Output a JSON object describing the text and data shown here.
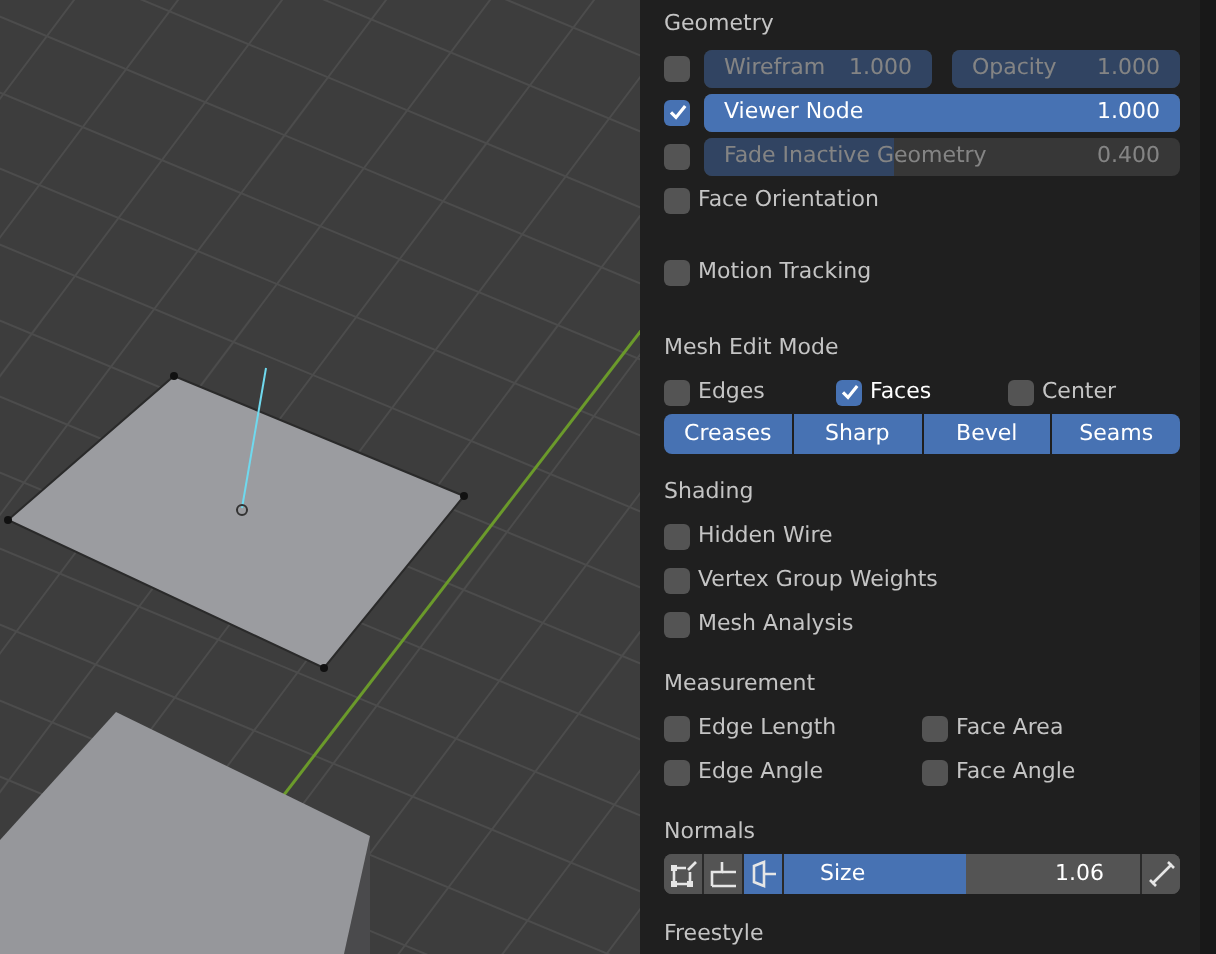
{
  "geometry": {
    "title": "Geometry",
    "items": [
      {
        "kind": "sliders",
        "checked": false,
        "sliders": [
          {
            "label": "Wirefram",
            "value": "1.000",
            "level": 1
          },
          {
            "label": "Opacity",
            "value": "1.000",
            "level": 1
          }
        ]
      },
      {
        "kind": "sliders",
        "checked": true,
        "sliders": [
          {
            "label": "Viewer Node",
            "value": "1.000",
            "level": 1
          }
        ]
      },
      {
        "kind": "sliders",
        "checked": false,
        "sliders": [
          {
            "label": "Fade Inactive Geometry",
            "value": "0.400",
            "level": 0.4
          }
        ]
      },
      {
        "kind": "checkbox",
        "label": "Face Orientation",
        "checked": false
      }
    ]
  },
  "motion_tracking": {
    "label": "Motion Tracking",
    "checked": false
  },
  "mesh_edit_mode": {
    "title": "Mesh Edit Mode",
    "checkboxes": [
      {
        "label": "Edges",
        "checked": false
      },
      {
        "label": "Faces",
        "checked": true
      },
      {
        "label": "Center",
        "checked": false
      }
    ],
    "toggles": [
      {
        "label": "Creases",
        "selected": true
      },
      {
        "label": "Sharp",
        "selected": true
      },
      {
        "label": "Bevel",
        "selected": true
      },
      {
        "label": "Seams",
        "selected": true
      }
    ]
  },
  "shading": {
    "title": "Shading",
    "items": [
      {
        "label": "Hidden Wire",
        "checked": false
      },
      {
        "label": "Vertex Group Weights",
        "checked": false
      },
      {
        "label": "Mesh Analysis",
        "checked": false
      }
    ]
  },
  "measurement": {
    "title": "Measurement",
    "items": [
      {
        "label": "Edge Length",
        "checked": false
      },
      {
        "label": "Face Area",
        "checked": false
      },
      {
        "label": "Edge Angle",
        "checked": false
      },
      {
        "label": "Face Angle",
        "checked": false
      }
    ]
  },
  "normals": {
    "title": "Normals",
    "buttons": [
      {
        "kind": "vertex",
        "selected": false
      },
      {
        "kind": "split",
        "selected": false
      },
      {
        "kind": "face",
        "selected": true
      }
    ],
    "size": {
      "label": "Size",
      "value": "1.06",
      "level": 0.51
    },
    "constant": {
      "selected": false
    }
  },
  "freestyle": {
    "title": "Freestyle"
  }
}
